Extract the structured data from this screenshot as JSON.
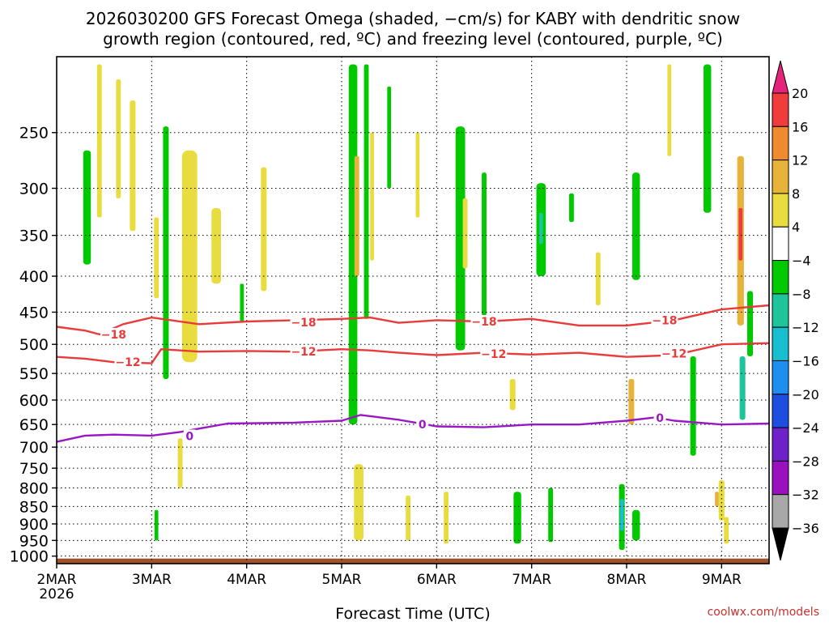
{
  "title_line1": "2026030200 GFS Forecast Omega (shaded, −cm/s) for KABY with dendritic snow",
  "title_line2": "growth region (contoured, red, ºC) and freezing level (contoured, purple, ºC)",
  "watermark": "coolwx.com/models",
  "chart_data": {
    "type": "heatmap",
    "title": "2026030200 GFS Forecast Omega (shaded, −cm/s) for KABY with dendritic snow growth region (contoured, red, ºC) and freezing level (contoured, purple, ºC)",
    "xlabel": "Forecast Time (UTC)",
    "ylabel": "",
    "x_ticks": [
      "2MAR",
      "3MAR",
      "4MAR",
      "5MAR",
      "6MAR",
      "7MAR",
      "8MAR",
      "9MAR"
    ],
    "x_year": "2026",
    "x_range_days": [
      0,
      7.5
    ],
    "y_ticks": [
      250,
      300,
      350,
      400,
      450,
      500,
      550,
      600,
      650,
      700,
      750,
      800,
      850,
      900,
      950,
      1000
    ],
    "y_range_hpa": [
      1025,
      195
    ],
    "y_scale": "log-pressure (reversed)",
    "grid": true,
    "colorbar": {
      "labels": [
        "20",
        "16",
        "12",
        "8",
        "4",
        "−4",
        "−8",
        "−12",
        "−16",
        "−20",
        "−24",
        "−28",
        "−32",
        "−36"
      ],
      "colors": [
        "#e4247a",
        "#f03c3c",
        "#ef8a2e",
        "#e8b33a",
        "#e9dc3f",
        "#ffffff",
        "#00c900",
        "#1ec59a",
        "#17bfd1",
        "#1e8ff0",
        "#1d4ee0",
        "#6f21c9",
        "#9b10be",
        "#a8a8a8",
        "#000000"
      ]
    },
    "contours": {
      "dgz_minus18": [
        [
          0,
          472
        ],
        [
          0.3,
          478
        ],
        [
          0.45,
          484
        ],
        [
          0.7,
          468
        ],
        [
          1.0,
          458
        ],
        [
          1.5,
          468
        ],
        [
          2.0,
          464
        ],
        [
          2.5,
          462
        ],
        [
          3.0,
          460
        ],
        [
          3.3,
          458
        ],
        [
          3.6,
          466
        ],
        [
          4.0,
          462
        ],
        [
          4.5,
          464
        ],
        [
          5.0,
          460
        ],
        [
          5.5,
          470
        ],
        [
          6.0,
          470
        ],
        [
          6.5,
          462
        ],
        [
          7.0,
          446
        ],
        [
          7.5,
          440
        ]
      ],
      "dgz_minus12": [
        [
          0,
          521
        ],
        [
          0.3,
          524
        ],
        [
          0.6,
          530
        ],
        [
          1.0,
          532
        ],
        [
          1.1,
          508
        ],
        [
          1.5,
          512
        ],
        [
          2.0,
          511
        ],
        [
          2.5,
          512
        ],
        [
          3.0,
          508
        ],
        [
          3.3,
          510
        ],
        [
          3.6,
          514
        ],
        [
          4.0,
          518
        ],
        [
          4.5,
          514
        ],
        [
          5.0,
          517
        ],
        [
          5.5,
          514
        ],
        [
          6.0,
          521
        ],
        [
          6.5,
          518
        ],
        [
          7.0,
          500
        ],
        [
          7.5,
          498
        ]
      ],
      "freezing_0C": [
        [
          0,
          688
        ],
        [
          0.3,
          674
        ],
        [
          0.6,
          672
        ],
        [
          1.0,
          674
        ],
        [
          1.3,
          666
        ],
        [
          1.8,
          648
        ],
        [
          2.5,
          646
        ],
        [
          3.0,
          642
        ],
        [
          3.2,
          630
        ],
        [
          3.6,
          640
        ],
        [
          4.0,
          654
        ],
        [
          4.5,
          656
        ],
        [
          5.0,
          650
        ],
        [
          5.5,
          650
        ],
        [
          6.0,
          642
        ],
        [
          6.3,
          635
        ],
        [
          6.5,
          642
        ],
        [
          7.0,
          650
        ],
        [
          7.5,
          648
        ]
      ],
      "labels": [
        {
          "text": "−18",
          "x": 0.6,
          "p": 484
        },
        {
          "text": "−18",
          "x": 2.6,
          "p": 465
        },
        {
          "text": "−18",
          "x": 4.5,
          "p": 464
        },
        {
          "text": "−18",
          "x": 6.4,
          "p": 462
        },
        {
          "text": "−12",
          "x": 0.75,
          "p": 530
        },
        {
          "text": "−12",
          "x": 2.6,
          "p": 512
        },
        {
          "text": "−12",
          "x": 4.6,
          "p": 516
        },
        {
          "text": "−12",
          "x": 6.5,
          "p": 515
        },
        {
          "text": "0",
          "x": 1.4,
          "p": 675
        },
        {
          "text": "0",
          "x": 3.85,
          "p": 650
        },
        {
          "text": "0",
          "x": 6.35,
          "p": 636
        }
      ]
    },
    "shaded_regions": [
      {
        "x": 0.32,
        "p1": 265,
        "p2": 385,
        "w": 0.08,
        "color": "#00c900"
      },
      {
        "x": 0.45,
        "p1": 200,
        "p2": 330,
        "w": 0.05,
        "color": "#e9dc3f"
      },
      {
        "x": 0.65,
        "p1": 210,
        "p2": 310,
        "w": 0.05,
        "color": "#e9dc3f"
      },
      {
        "x": 0.8,
        "p1": 225,
        "p2": 345,
        "w": 0.06,
        "color": "#e9dc3f"
      },
      {
        "x": 1.05,
        "p1": 330,
        "p2": 430,
        "w": 0.05,
        "color": "#e9dc3f"
      },
      {
        "x": 1.15,
        "p1": 245,
        "p2": 560,
        "w": 0.06,
        "color": "#00c900"
      },
      {
        "x": 1.4,
        "p1": 265,
        "p2": 530,
        "w": 0.16,
        "color": "#e9dc3f"
      },
      {
        "x": 1.68,
        "p1": 320,
        "p2": 410,
        "w": 0.1,
        "color": "#e9dc3f"
      },
      {
        "x": 1.95,
        "p1": 410,
        "p2": 465,
        "w": 0.04,
        "color": "#00c900"
      },
      {
        "x": 2.18,
        "p1": 280,
        "p2": 420,
        "w": 0.06,
        "color": "#e9dc3f"
      },
      {
        "x": 3.12,
        "p1": 200,
        "p2": 650,
        "w": 0.09,
        "color": "#00c900"
      },
      {
        "x": 3.16,
        "p1": 270,
        "p2": 400,
        "w": 0.05,
        "color": "#e8b33a"
      },
      {
        "x": 3.26,
        "p1": 200,
        "p2": 460,
        "w": 0.05,
        "color": "#00c900"
      },
      {
        "x": 3.32,
        "p1": 250,
        "p2": 380,
        "w": 0.04,
        "color": "#e9dc3f"
      },
      {
        "x": 3.5,
        "p1": 215,
        "p2": 300,
        "w": 0.04,
        "color": "#00c900"
      },
      {
        "x": 3.8,
        "p1": 250,
        "p2": 330,
        "w": 0.04,
        "color": "#e9dc3f"
      },
      {
        "x": 4.25,
        "p1": 245,
        "p2": 510,
        "w": 0.1,
        "color": "#00c900"
      },
      {
        "x": 4.3,
        "p1": 310,
        "p2": 390,
        "w": 0.05,
        "color": "#e9dc3f"
      },
      {
        "x": 4.5,
        "p1": 285,
        "p2": 455,
        "w": 0.05,
        "color": "#00c900"
      },
      {
        "x": 5.1,
        "p1": 295,
        "p2": 400,
        "w": 0.1,
        "color": "#00c900"
      },
      {
        "x": 5.1,
        "p1": 325,
        "p2": 360,
        "w": 0.04,
        "color": "#1ec59a"
      },
      {
        "x": 5.42,
        "p1": 305,
        "p2": 335,
        "w": 0.05,
        "color": "#00c900"
      },
      {
        "x": 5.7,
        "p1": 370,
        "p2": 440,
        "w": 0.05,
        "color": "#e9dc3f"
      },
      {
        "x": 6.1,
        "p1": 285,
        "p2": 405,
        "w": 0.08,
        "color": "#00c900"
      },
      {
        "x": 6.45,
        "p1": 200,
        "p2": 270,
        "w": 0.04,
        "color": "#e9dc3f"
      },
      {
        "x": 6.85,
        "p1": 200,
        "p2": 325,
        "w": 0.08,
        "color": "#00c900"
      },
      {
        "x": 7.2,
        "p1": 270,
        "p2": 470,
        "w": 0.07,
        "color": "#e8b33a"
      },
      {
        "x": 7.2,
        "p1": 320,
        "p2": 380,
        "w": 0.04,
        "color": "#f03c3c"
      },
      {
        "x": 7.3,
        "p1": 420,
        "p2": 520,
        "w": 0.06,
        "color": "#00c900"
      },
      {
        "x": 7.22,
        "p1": 520,
        "p2": 640,
        "w": 0.06,
        "color": "#1ec59a"
      },
      {
        "x": 4.8,
        "p1": 560,
        "p2": 620,
        "w": 0.06,
        "color": "#e9dc3f"
      },
      {
        "x": 6.05,
        "p1": 560,
        "p2": 650,
        "w": 0.06,
        "color": "#e8b33a"
      },
      {
        "x": 6.7,
        "p1": 520,
        "p2": 720,
        "w": 0.06,
        "color": "#00c900"
      },
      {
        "x": 3.18,
        "p1": 740,
        "p2": 950,
        "w": 0.1,
        "color": "#e9dc3f"
      },
      {
        "x": 4.85,
        "p1": 810,
        "p2": 960,
        "w": 0.08,
        "color": "#00c900"
      },
      {
        "x": 6.1,
        "p1": 860,
        "p2": 950,
        "w": 0.08,
        "color": "#00c900"
      },
      {
        "x": 7.05,
        "p1": 880,
        "p2": 960,
        "w": 0.05,
        "color": "#e9dc3f"
      },
      {
        "x": 7.0,
        "p1": 780,
        "p2": 890,
        "w": 0.06,
        "color": "#e9dc3f"
      },
      {
        "x": 6.95,
        "p1": 810,
        "p2": 850,
        "w": 0.04,
        "color": "#e8b33a"
      },
      {
        "x": 5.95,
        "p1": 790,
        "p2": 980,
        "w": 0.06,
        "color": "#00c900"
      },
      {
        "x": 5.95,
        "p1": 830,
        "p2": 920,
        "w": 0.04,
        "color": "#17bfd1"
      },
      {
        "x": 1.05,
        "p1": 860,
        "p2": 950,
        "w": 0.04,
        "color": "#00c900"
      },
      {
        "x": 3.7,
        "p1": 820,
        "p2": 950,
        "w": 0.05,
        "color": "#e9dc3f"
      },
      {
        "x": 4.1,
        "p1": 810,
        "p2": 960,
        "w": 0.05,
        "color": "#e9dc3f"
      },
      {
        "x": 5.2,
        "p1": 800,
        "p2": 955,
        "w": 0.05,
        "color": "#00c900"
      },
      {
        "x": 1.3,
        "p1": 680,
        "p2": 800,
        "w": 0.05,
        "color": "#e9dc3f"
      }
    ],
    "ground": {
      "p1": 1008,
      "p2": 1025,
      "color": "#a0522d"
    }
  }
}
